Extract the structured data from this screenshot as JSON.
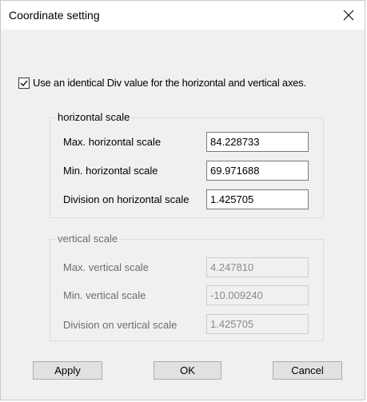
{
  "dialog": {
    "title": "Coordinate setting"
  },
  "checkbox": {
    "label": "Use an identical Div value for the horizontal and vertical axes.",
    "checked": true
  },
  "horizontal": {
    "group_title": "horizontal scale",
    "max_label": "Max. horizontal scale",
    "max_value": "84.228733",
    "min_label": "Min. horizontal scale",
    "min_value": "69.971688",
    "div_label": "Division on horizontal scale",
    "div_value": "1.425705"
  },
  "vertical": {
    "group_title": "vertical scale",
    "max_label": "Max. vertical scale",
    "max_value": "4.247810",
    "min_label": "Min. vertical scale",
    "min_value": "-10.009240",
    "div_label": "Division on vertical scale",
    "div_value": "1.425705"
  },
  "buttons": {
    "apply": "Apply",
    "ok": "OK",
    "cancel": "Cancel"
  }
}
